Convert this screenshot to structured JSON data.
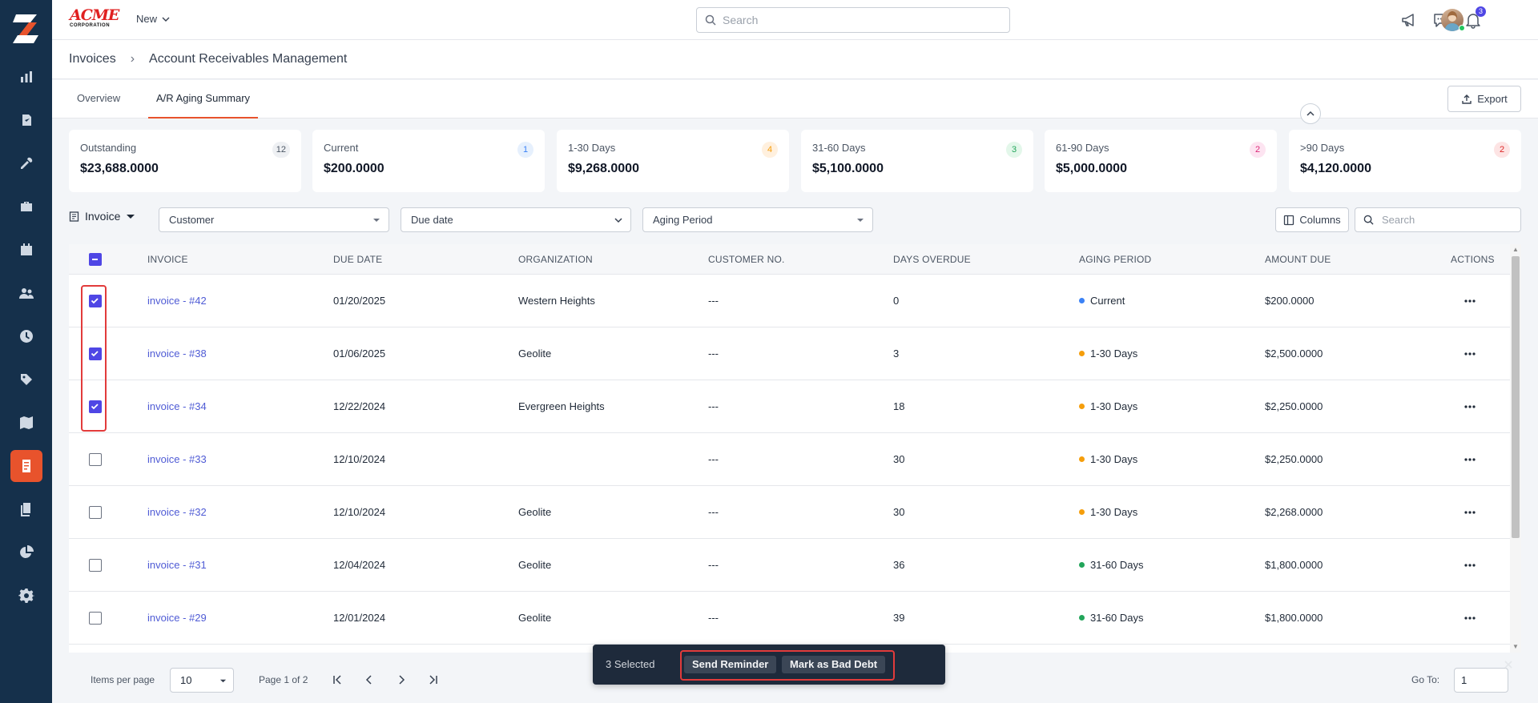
{
  "topbar": {
    "brand_name": "ACME",
    "brand_sub": "CORPORATION",
    "new_label": "New",
    "search_placeholder": "Search",
    "notification_count": "3"
  },
  "breadcrumb": {
    "parent": "Invoices",
    "current": "Account Receivables Management"
  },
  "tabs": {
    "overview": "Overview",
    "aging_summary": "A/R Aging Summary",
    "export_label": "Export"
  },
  "cards": [
    {
      "label": "Outstanding",
      "value": "$23,688.0000",
      "count": "12",
      "badge_bg": "#eef0f3",
      "badge_fg": "#4b5563"
    },
    {
      "label": "Current",
      "value": "$200.0000",
      "count": "1",
      "badge_bg": "#e6f0fd",
      "badge_fg": "#3b82f6"
    },
    {
      "label": "1-30 Days",
      "value": "$9,268.0000",
      "count": "4",
      "badge_bg": "#fff0de",
      "badge_fg": "#f59e0b"
    },
    {
      "label": "31-60 Days",
      "value": "$5,100.0000",
      "count": "3",
      "badge_bg": "#e3f7ea",
      "badge_fg": "#22a55a"
    },
    {
      "label": "61-90 Days",
      "value": "$5,000.0000",
      "count": "2",
      "badge_bg": "#fde4f1",
      "badge_fg": "#db2777"
    },
    {
      "label": ">90 Days",
      "value": "$4,120.0000",
      "count": "2",
      "badge_bg": "#fde4e4",
      "badge_fg": "#dc2626"
    }
  ],
  "filters": {
    "title": "Invoice",
    "customer": "Customer",
    "due_date": "Due date",
    "aging_period": "Aging Period",
    "columns_label": "Columns",
    "search_placeholder": "Search"
  },
  "table": {
    "headers": {
      "invoice": "INVOICE",
      "due_date": "DUE DATE",
      "organization": "ORGANIZATION",
      "customer_no": "CUSTOMER NO.",
      "days_overdue": "DAYS OVERDUE",
      "aging_period": "AGING PERIOD",
      "amount_due": "AMOUNT DUE",
      "actions": "ACTIONS"
    },
    "rows": [
      {
        "invoice": "invoice - #42",
        "due_date": "01/20/2025",
        "organization": "Western Heights",
        "customer_no": "---",
        "days_overdue": "0",
        "aging": "Current",
        "aging_color": "#3b82f6",
        "amount": "$200.0000",
        "checked": true
      },
      {
        "invoice": "invoice - #38",
        "due_date": "01/06/2025",
        "organization": "Geolite",
        "customer_no": "---",
        "days_overdue": "3",
        "aging": "1-30 Days",
        "aging_color": "#f59e0b",
        "amount": "$2,500.0000",
        "checked": true
      },
      {
        "invoice": "invoice - #34",
        "due_date": "12/22/2024",
        "organization": "Evergreen Heights",
        "customer_no": "---",
        "days_overdue": "18",
        "aging": "1-30 Days",
        "aging_color": "#f59e0b",
        "amount": "$2,250.0000",
        "checked": true
      },
      {
        "invoice": "invoice - #33",
        "due_date": "12/10/2024",
        "organization": "",
        "customer_no": "---",
        "days_overdue": "30",
        "aging": "1-30 Days",
        "aging_color": "#f59e0b",
        "amount": "$2,250.0000",
        "checked": false
      },
      {
        "invoice": "invoice - #32",
        "due_date": "12/10/2024",
        "organization": "Geolite",
        "customer_no": "---",
        "days_overdue": "30",
        "aging": "1-30 Days",
        "aging_color": "#f59e0b",
        "amount": "$2,268.0000",
        "checked": false
      },
      {
        "invoice": "invoice - #31",
        "due_date": "12/04/2024",
        "organization": "Geolite",
        "customer_no": "---",
        "days_overdue": "36",
        "aging": "31-60 Days",
        "aging_color": "#22a55a",
        "amount": "$1,800.0000",
        "checked": false
      },
      {
        "invoice": "invoice - #29",
        "due_date": "12/01/2024",
        "organization": "Geolite",
        "customer_no": "---",
        "days_overdue": "39",
        "aging": "31-60 Days",
        "aging_color": "#22a55a",
        "amount": "$1,800.0000",
        "checked": false
      }
    ]
  },
  "pagination": {
    "items_per_page_label": "Items per page",
    "items_per_page": "10",
    "page_info": "Page 1 of 2",
    "goto_label": "Go To:",
    "goto_value": "1"
  },
  "bulk": {
    "selected": "3 Selected",
    "send_reminder": "Send Reminder",
    "mark_bad_debt": "Mark as Bad Debt"
  },
  "colors": {
    "accent": "#e8532c",
    "sidebar": "#15304b",
    "link": "#4f5bd5",
    "checkbox": "#4f46e5"
  }
}
